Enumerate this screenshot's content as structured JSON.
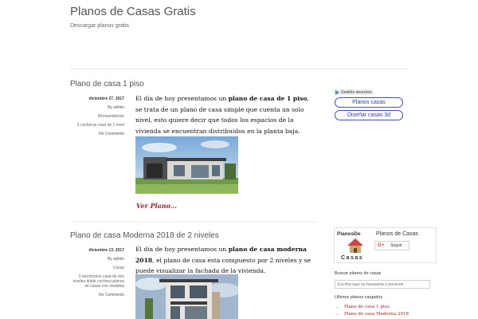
{
  "site": {
    "title": "Planos de Casas Gratis",
    "tagline": "Descargar planos gratis"
  },
  "posts": [
    {
      "title": "Plano de casa 1 piso",
      "date": "diciembre 27, 2017",
      "author": "By admin",
      "category": "Monoambiente",
      "comments_count": "2 cocheras casa de 1 nivel",
      "comments": "No Comments",
      "body_1": "El día de hoy presentamos un ",
      "body_bold_1": "plano de casa de 1 piso",
      "body_2": ", se trata de un plano de casa simple que cuenta un solo nivel, esto quiere decir que todos los espacios de la vivienda se encuentran distribuidos en la planta baja.",
      "read_more": "Ver Plano…"
    },
    {
      "title": "Plano de casa Moderna 2018 de 2 niveles",
      "date": "diciembre 13, 2017",
      "author": "By admin",
      "category": "Casas",
      "tags": "3 dormitorios casa de dos niveles doble cochera planos de casas con medidas",
      "comments": "No Comments",
      "body_1": "El día de hoy presentamos un ",
      "body_bold_1": "plano de casa moderna 2018",
      "body_2": ", el plano de casa esta compuesto por 2 niveles y se puede visualizar la fachada de la vivienda."
    }
  ],
  "sidebar": {
    "ad_label": "Gestión anuncios",
    "pills": [
      "Planos casas",
      "Diseñar casas 3d"
    ],
    "social": {
      "logo_text_top": "PlanosDe",
      "logo_text_bottom": "Casas",
      "page_name": "Planos de Casas",
      "follow_label": "Seguir",
      "gplus_glyph": "G+"
    },
    "search_heading": "Buscar planos de casas",
    "search_placeholder": "Escriba aquí su búsqueda y presione",
    "recent_heading": "Ultimos planos cargados",
    "recent": [
      "Plano de casa 1 piso",
      "Plano de casa Moderna 2018"
    ]
  },
  "colors": {
    "link_red": "#a5242a",
    "pill_blue": "#3f4fc0",
    "text": "#333333"
  }
}
